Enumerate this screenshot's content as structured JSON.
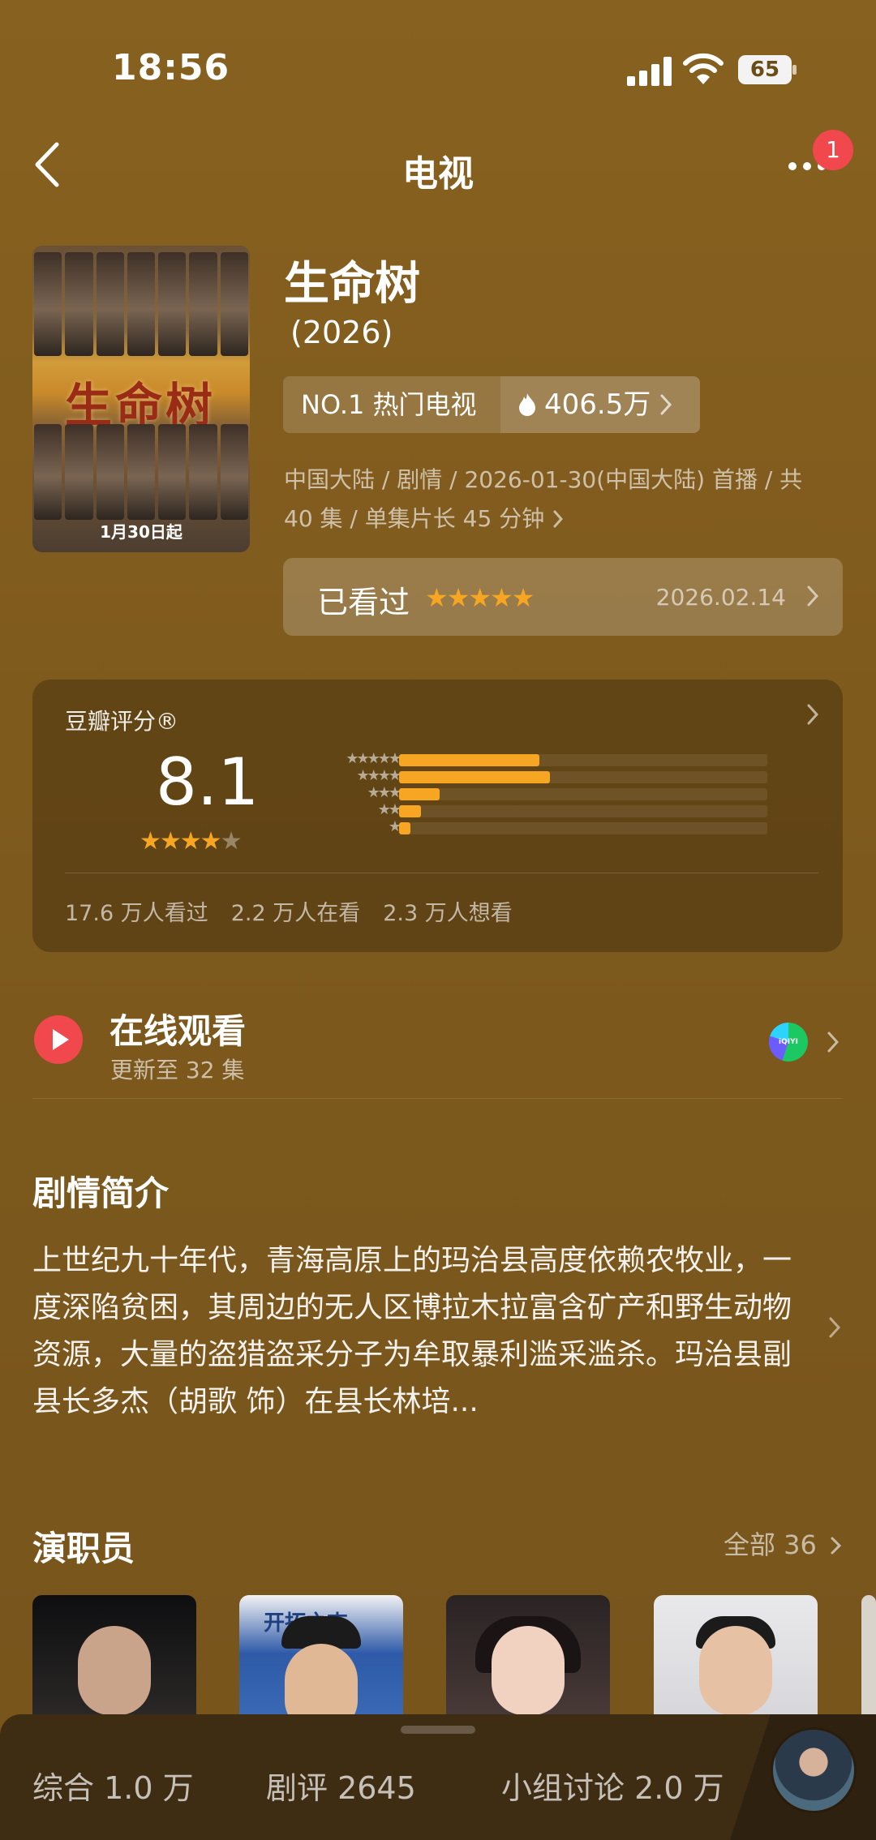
{
  "status_bar": {
    "time": "18:56",
    "battery": "65"
  },
  "nav": {
    "title": "电视",
    "badge": "1"
  },
  "poster": {
    "title": "生命树",
    "date": "1月30日起"
  },
  "show": {
    "title": "生命树",
    "year": "(2026)",
    "rank_label": "NO.1 热门电视",
    "heat": "406.5万",
    "meta_line1": "中国大陆 / 剧情 / 2026-01-30(中国大陆) 首播 / 共",
    "meta_line2": "40 集 / 单集片长 45 分钟",
    "watched_label": "已看过",
    "watched_stars": "★★★★★",
    "watched_date": "2026.02.14"
  },
  "rating": {
    "label": "豆瓣评分®",
    "score": "8.1",
    "stars_on": "★★★★",
    "stars_off": "★",
    "distribution": [
      {
        "stars": "★★★★★",
        "fraction": 0.38
      },
      {
        "stars": "★★★★",
        "fraction": 0.41
      },
      {
        "stars": "★★★",
        "fraction": 0.11
      },
      {
        "stars": "★★",
        "fraction": 0.06
      },
      {
        "stars": "★",
        "fraction": 0.03
      }
    ],
    "watched": "17.6 万人看过",
    "watching": "2.2 万人在看",
    "want": "2.3 万人想看"
  },
  "online": {
    "title": "在线观看",
    "subtitle": "更新至 32 集",
    "platform": "iQIYI"
  },
  "synopsis": {
    "title": "剧情简介",
    "text": "上世纪九十年代，青海高原上的玛治县高度依赖农牧业，一度深陷贫困，其周边的无人区博拉木拉富含矿产和野生动物资源，大量的盗猎盗采分子为牟取暴利滥采滥杀。玛治县副县长多杰（胡歌 饰）在县长林培..."
  },
  "cast": {
    "title": "演职员",
    "all_label": "全部 36",
    "banner_text": "开拓之吉"
  },
  "bottom_tabs": [
    {
      "label": "综合 1.0 万"
    },
    {
      "label": "剧评 2645"
    },
    {
      "label": "小组讨论 2.0 万"
    }
  ],
  "colors": {
    "accent": "#f6a623",
    "badge": "#f0484d",
    "background": "#7e5a1d"
  }
}
